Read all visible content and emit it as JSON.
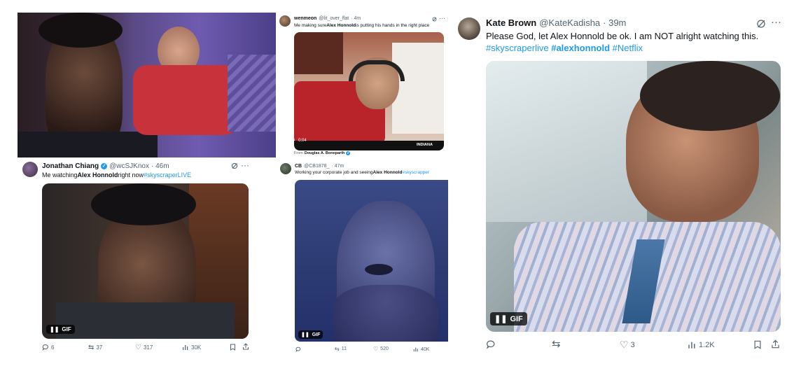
{
  "colors": {
    "link": "#1d9bf0",
    "muted": "#536471",
    "text": "#0f1419"
  },
  "panel1": {
    "author": "Jonathan Chiang",
    "handle": "@wcSJKnox",
    "time": "· 46m",
    "text_pre": "Me watching ",
    "text_bold": "Alex Honnold",
    "text_mid": " right now ",
    "hashtag": "#skyscraperLIVE",
    "gif_label": "GIF",
    "replies": "6",
    "reposts": "37",
    "likes": "317",
    "views": "30K"
  },
  "panel2": {
    "author": "wenmeon",
    "handle": "@lit_over_flat",
    "time": "· 4m",
    "text_pre": "Me making sure ",
    "text_bold": "Alex Honnold",
    "text_post": " is putting his hands in the right place",
    "video_time": "0:04",
    "scoreboard": "INDIANA",
    "source_prefix": "From",
    "source_name": "Douglas A. Boneparth"
  },
  "panel3": {
    "author": "CB",
    "handle": "@CB1878_",
    "time": "· 47m",
    "text_pre": "Working your corporate job and seeing ",
    "text_bold": "Alex Honnold",
    "hashtag": " #skyscrapper",
    "gif_label": "GIF",
    "reposts": "11",
    "likes": "520",
    "views": "40K"
  },
  "panel4": {
    "author": "Kate Brown",
    "handle": "@KateKadisha",
    "time": "· 39m",
    "text": "Please God, let Alex Honnold be ok. I am NOT alright watching this.",
    "tag1": "#skyscraperlive",
    "tag2": "#alexhonnold",
    "tag3": "#Netflix",
    "gif_label": "GIF",
    "likes": "3",
    "views": "1.2K"
  }
}
